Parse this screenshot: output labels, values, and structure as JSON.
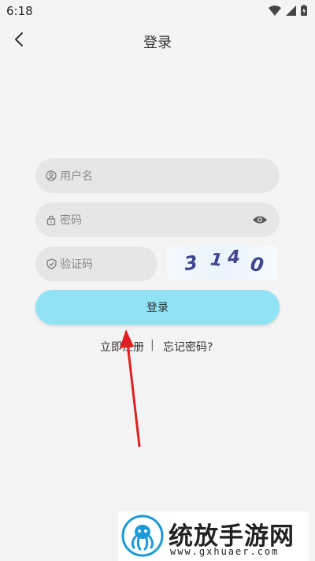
{
  "status_bar": {
    "time": "6:18"
  },
  "nav": {
    "title": "登录"
  },
  "form": {
    "username_placeholder": "用户名",
    "password_placeholder": "密码",
    "captcha_placeholder": "验证码",
    "captcha_digits": [
      "3",
      "1",
      "4",
      "0"
    ]
  },
  "login_button": "登录",
  "links": {
    "register": "立即注册",
    "separator": "|",
    "forgot": "忘记密码?"
  },
  "colors": {
    "login_button": "#8fe3f4",
    "field_bg": "#e6e6e6",
    "arrow": "#e02020",
    "captcha_text": "#3f4690"
  },
  "watermark": {
    "title": "统放手游网",
    "url": "www.gxhuaer.com"
  }
}
